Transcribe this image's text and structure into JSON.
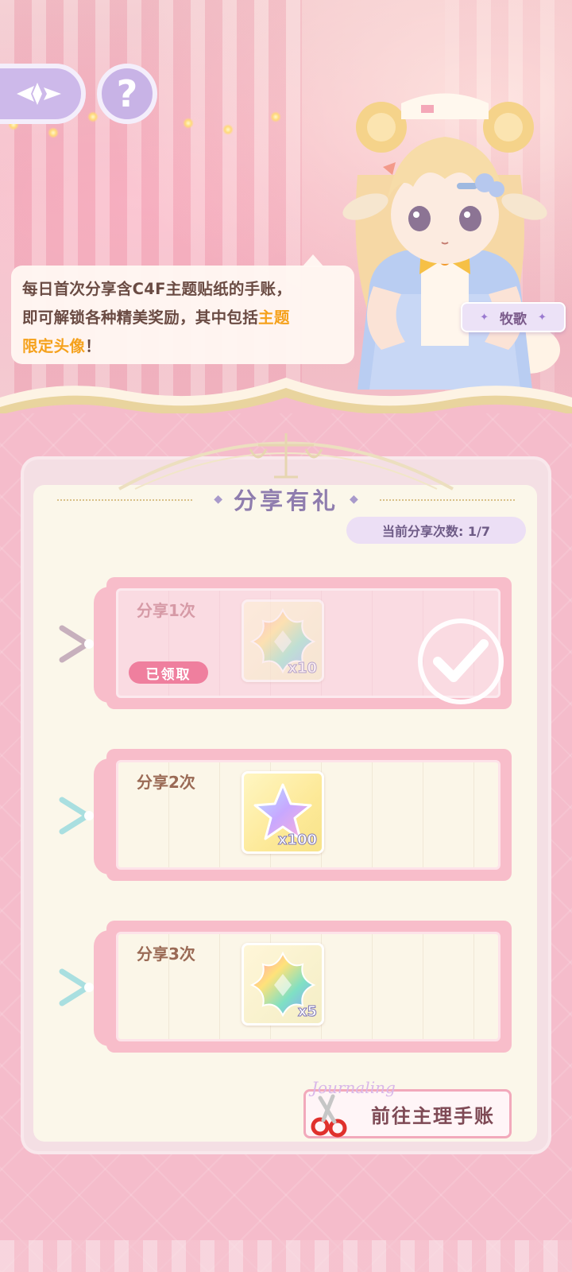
{
  "speech": {
    "line1": "每日首次分享含C4F主题贴纸的手账，",
    "line2_pre": "即可解锁各种精美奖励，其中包括",
    "line2_hl": "主题",
    "line3_hl": "限定头像",
    "line3_post": "！"
  },
  "character": {
    "name": "牧歌"
  },
  "panel": {
    "title": "分享有礼",
    "counter": "当前分享次数: 1/7"
  },
  "rewards": [
    {
      "label": "分享1次",
      "qty": "x10",
      "status": "已领取",
      "claimed": true,
      "icon": "rainbow-star-crystal"
    },
    {
      "label": "分享2次",
      "qty": "x100",
      "claimed": false,
      "icon": "star-crystal"
    },
    {
      "label": "分享3次",
      "qty": "x5",
      "claimed": false,
      "icon": "rainbow-star-crystal"
    }
  ],
  "go_button": {
    "label": "前往主理手账",
    "decoration": "Journaling"
  },
  "colors": {
    "highlight": "#f5a11b",
    "claimed_badge": "#ef7f9e",
    "panel_bg": "#fbf7ea",
    "title": "#8f7dae"
  }
}
